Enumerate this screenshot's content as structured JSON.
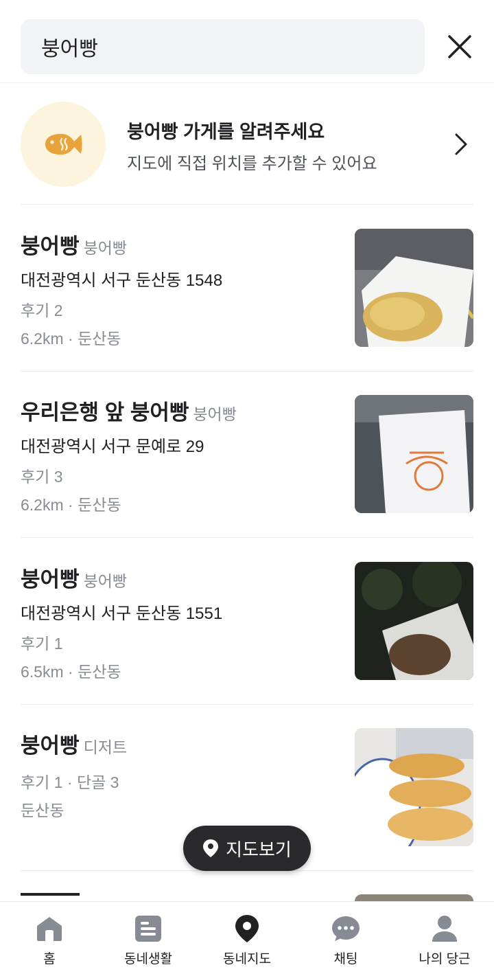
{
  "search": {
    "value": "붕어빵",
    "close_icon": "close-icon"
  },
  "banner": {
    "icon": "fish-bread-icon",
    "title": "붕어빵 가게를 알려주세요",
    "subtitle": "지도에 직접 위치를 추가할 수 있어요"
  },
  "stores": [
    {
      "name": "붕어빵",
      "category": "붕어빵",
      "address": "대전광역시 서구 둔산동 1548",
      "meta1": "후기 2",
      "meta2": "6.2km · 둔산동"
    },
    {
      "name": "우리은행 앞 붕어빵",
      "category": "붕어빵",
      "address": "대전광역시 서구 문예로 29",
      "meta1": "후기 3",
      "meta2": "6.2km · 둔산동"
    },
    {
      "name": "붕어빵",
      "category": "붕어빵",
      "address": "대전광역시 서구 둔산동 1551",
      "meta1": "후기 1",
      "meta2": "6.5km · 둔산동"
    },
    {
      "name": "붕어빵",
      "category": "디저트",
      "meta1": "후기 1 · 단골 3",
      "meta2": "둔산동"
    }
  ],
  "map_button": {
    "label": "지도보기"
  },
  "tabs": [
    {
      "label": "홈",
      "icon": "home-icon"
    },
    {
      "label": "동네생활",
      "icon": "document-icon"
    },
    {
      "label": "동네지도",
      "icon": "map-pin-icon"
    },
    {
      "label": "채팅",
      "icon": "chat-icon"
    },
    {
      "label": "나의 당근",
      "icon": "profile-icon"
    }
  ],
  "colors": {
    "accent_yellow": "#e8a33d",
    "text_primary": "#212124",
    "text_secondary": "#868b94",
    "search_bg": "#f2f3f6"
  }
}
